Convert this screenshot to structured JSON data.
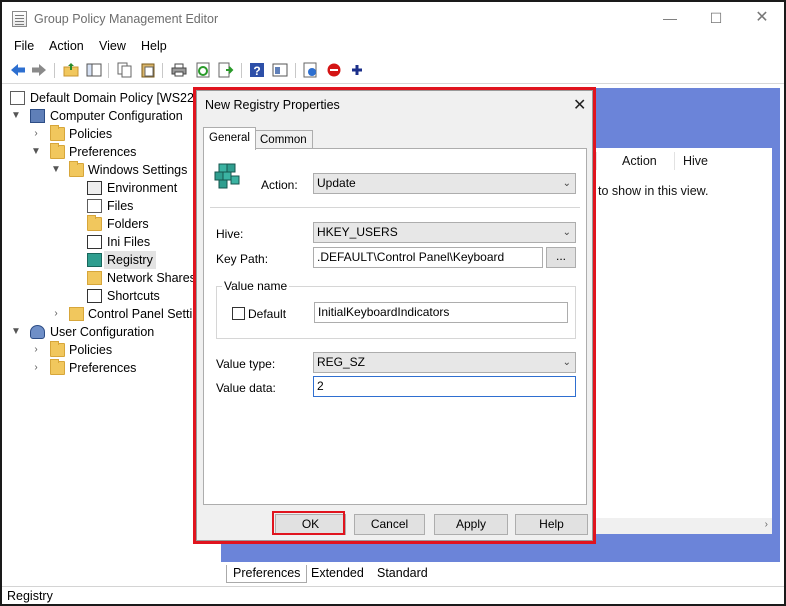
{
  "window": {
    "title": "Group Policy Management Editor",
    "minimize": "—",
    "maximize": "☐",
    "close": "✕"
  },
  "menu": [
    "File",
    "Action",
    "View",
    "Help"
  ],
  "toolbar_icons": [
    "back-icon",
    "forward-icon",
    "up-folder-icon",
    "show-hide-tree-icon",
    "copy-icon",
    "paste-icon",
    "print-icon",
    "refresh-icon",
    "export-icon",
    "help-icon",
    "properties-icon",
    "import-icon",
    "disable-icon",
    "add-icon"
  ],
  "tree": {
    "root": "Default Domain Policy [WS22DC",
    "items": [
      {
        "label": "Computer Configuration"
      },
      {
        "label": "Policies"
      },
      {
        "label": "Preferences"
      },
      {
        "label": "Windows Settings"
      },
      {
        "label": "Environment"
      },
      {
        "label": "Files"
      },
      {
        "label": "Folders"
      },
      {
        "label": "Ini Files"
      },
      {
        "label": "Registry"
      },
      {
        "label": "Network Shares"
      },
      {
        "label": "Shortcuts"
      },
      {
        "label": "Control Panel Setting"
      },
      {
        "label": "User Configuration"
      },
      {
        "label": "Policies"
      },
      {
        "label": "Preferences"
      }
    ]
  },
  "list": {
    "columns": [
      "Action",
      "Hive"
    ],
    "empty_message": "to show in this view."
  },
  "bottom_tabs": [
    "Preferences",
    "Extended",
    "Standard"
  ],
  "status": "Registry",
  "dialog": {
    "title": "New Registry Properties",
    "close": "✕",
    "tabs": [
      "General",
      "Common"
    ],
    "action_label": "Action:",
    "action_value": "Update",
    "hive_label": "Hive:",
    "hive_value": "HKEY_USERS",
    "keypath_label": "Key Path:",
    "keypath_value": ".DEFAULT\\Control Panel\\Keyboard",
    "browse": "...",
    "value_name_group": "Value name",
    "default_label": "Default",
    "value_name": "InitialKeyboardIndicators",
    "value_type_label": "Value type:",
    "value_type": "REG_SZ",
    "value_data_label": "Value data:",
    "value_data": "2",
    "buttons": {
      "ok": "OK",
      "cancel": "Cancel",
      "apply": "Apply",
      "help": "Help"
    }
  },
  "colors": {
    "highlight": "#e0141e",
    "pane_blue": "#6b84d9"
  }
}
